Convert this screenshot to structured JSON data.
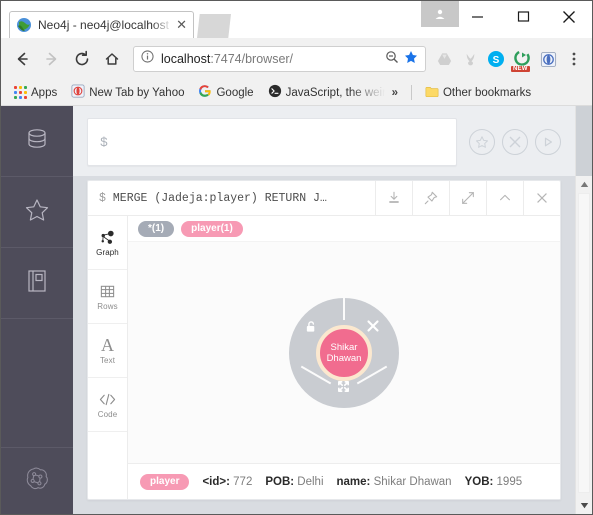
{
  "window": {
    "tab_title": "Neo4j - neo4j@localhost",
    "tab_close_label": "✕",
    "minimize_label": "—",
    "maximize_label": "☐",
    "close_label": "✕",
    "profile_icon": "user-avatar-icon",
    "favicon": "neo4j-globe-icon"
  },
  "toolbar": {
    "back_icon": "arrow-left-icon",
    "forward_icon": "arrow-right-icon",
    "reload_icon": "reload-icon",
    "home_icon": "home-icon",
    "info_icon": "page-info-icon",
    "url_host": "localhost",
    "url_path": ":7474/browser/",
    "url_full": "localhost:7474/browser/",
    "zoom_out_icon": "zoom-out-icon",
    "bookmark_star_icon": "star-filled-icon",
    "menu_icon": "kebab-menu-icon",
    "extensions": [
      {
        "name": "google-drive-icon",
        "label": ""
      },
      {
        "name": "rabbit-icon",
        "label": ""
      },
      {
        "name": "skype-icon",
        "label": "S"
      },
      {
        "name": "green-shield-icon",
        "label": "",
        "badge": "NEW"
      },
      {
        "name": "opera-widget-icon",
        "label": ""
      }
    ]
  },
  "bookmarks": {
    "apps_label": "Apps",
    "items": [
      {
        "label": "New Tab by Yahoo",
        "icon": "yahoo-icon"
      },
      {
        "label": "Google",
        "icon": "google-g-icon"
      },
      {
        "label": "JavaScript, the weird p",
        "icon": "terminal-icon"
      }
    ],
    "overflow_label": "»",
    "other_bookmarks_label": "Other bookmarks",
    "folder_icon": "folder-icon"
  },
  "neo4j": {
    "sidebar": [
      {
        "name": "database-icon",
        "label": "Database Information"
      },
      {
        "name": "star-icon",
        "label": "Favorites"
      },
      {
        "name": "documents-icon",
        "label": "Documents"
      }
    ],
    "sidebar_bottom": {
      "name": "neo4j-brain-icon",
      "label": "About Neo4j"
    },
    "editor": {
      "prompt": "$",
      "value": "",
      "placeholder": "",
      "actions": [
        {
          "name": "favorite-star-button",
          "glyph": "☆"
        },
        {
          "name": "clear-editor-button",
          "glyph": "✕"
        },
        {
          "name": "run-query-button",
          "glyph": "▷"
        }
      ]
    },
    "frame": {
      "prompt": "$",
      "query": "MERGE (Jadeja:player) RETURN J…",
      "actions": [
        {
          "name": "download-button",
          "glyph": "download"
        },
        {
          "name": "pin-button",
          "glyph": "pin"
        },
        {
          "name": "fullscreen-button",
          "glyph": "expand"
        },
        {
          "name": "collapse-button",
          "glyph": "chevron-up"
        },
        {
          "name": "close-frame-button",
          "glyph": "close"
        }
      ],
      "view_tabs": [
        {
          "label": "Graph",
          "icon": "graph-icon",
          "active": true
        },
        {
          "label": "Rows",
          "icon": "table-icon",
          "active": false
        },
        {
          "label": "Text",
          "icon": "text-a-icon",
          "active": false
        },
        {
          "label": "Code",
          "icon": "code-icon",
          "active": false
        }
      ],
      "legend": [
        {
          "label": "*(1)",
          "color": "#a5abb6"
        },
        {
          "label": "player(1)",
          "color": "#f79ab4"
        }
      ],
      "graph": {
        "node_label": "Shikar Dhawan",
        "node_color": "#f16c8f",
        "node_ring_color": "#c9ccd1",
        "ring_actions": [
          {
            "name": "unlock-node-icon",
            "position": "top-left"
          },
          {
            "name": "dismiss-node-icon",
            "position": "top-right"
          },
          {
            "name": "expand-node-icon",
            "position": "bottom"
          }
        ]
      },
      "properties": {
        "badge": "player",
        "badge_color": "#f79ab4",
        "items": [
          {
            "key": "<id>:",
            "value": "772"
          },
          {
            "key": "POB:",
            "value": "Delhi"
          },
          {
            "key": "name:",
            "value": "Shikar Dhawan"
          },
          {
            "key": "YOB:",
            "value": "1995"
          }
        ]
      }
    }
  },
  "scrollbar": {
    "up_arrow": "▲",
    "down_arrow": "▼"
  }
}
